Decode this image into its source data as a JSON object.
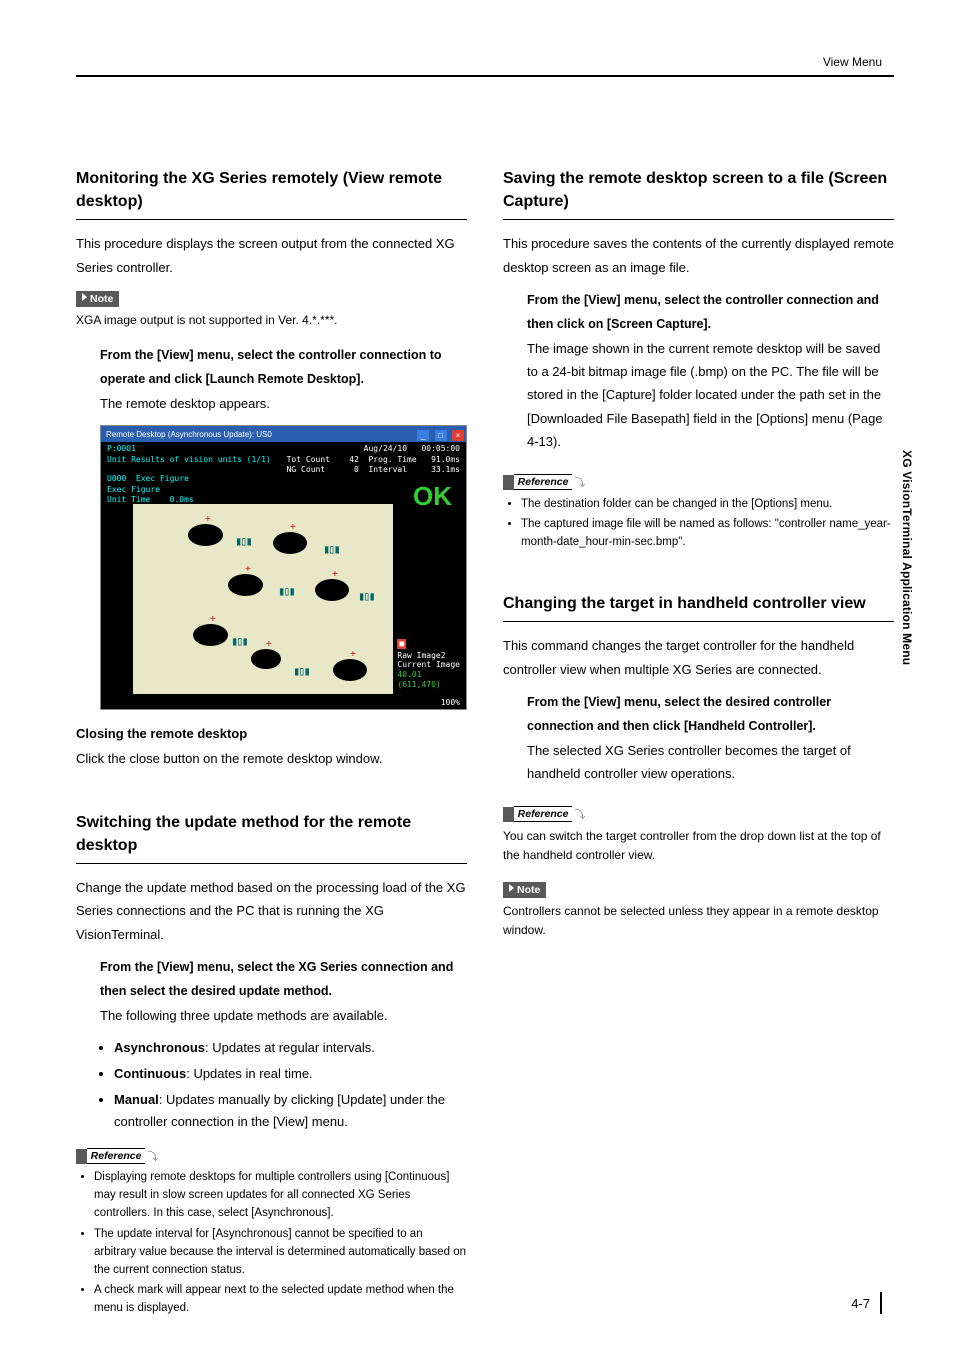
{
  "header": {
    "section_label": "View Menu"
  },
  "side_tab": "XG VisionTerminal Application Menu",
  "left": {
    "sec1": {
      "title": "Monitoring the XG Series remotely (View remote desktop)",
      "intro": "This procedure displays the screen output from the connected XG Series controller.",
      "note_label": "Note",
      "note_text": "XGA image output is not supported in Ver. 4.*.***.",
      "step_head": "From the [View] menu, select the controller connection to operate and click [Launch Remote Desktop].",
      "step_body": "The remote desktop appears.",
      "fig": {
        "titlebar": "Remote Desktop (Asynchronous Update): US0",
        "top_left_l1": "P:0001",
        "top_left_l2": "Unit Results of vision units (1/1)",
        "top_right": "Aug/24/10   00:05:00\nTot Count    42  Prog. Time   91.0ms\nNG Count      0  Interval     33.1ms",
        "left_stats": "U000  Exec Figure\nExec Figure\nUnit Time    0.0ms",
        "ok": "OK",
        "rside_flag": "■",
        "rside_lines": "Raw Image2\nCurrent Image",
        "rside_green": "40.01\n(611,470)",
        "bottom_pct": "100%"
      },
      "sub_head": "Closing the remote desktop",
      "sub_body": "Click the close button on the remote desktop window."
    },
    "sec2": {
      "title": "Switching the update method for the remote desktop",
      "intro": "Change the update method based on the processing load of the XG Series connections and the PC that is running the XG VisionTerminal.",
      "step_head": "From the [View] menu, select the XG Series connection and then select the desired update method.",
      "step_body": "The following three update methods are available.",
      "bullets": [
        {
          "b": "Asynchronous",
          "t": ": Updates at regular intervals."
        },
        {
          "b": "Continuous",
          "t": ": Updates in real time."
        },
        {
          "b": "Manual",
          "t": ": Updates manually by clicking [Update] under the controller connection in the [View] menu."
        }
      ],
      "ref_label": "Reference",
      "refs": [
        "Displaying remote desktops for multiple controllers using [Continuous] may result in slow screen updates for all connected XG Series controllers. In this case, select [Asynchronous].",
        "The update interval for [Asynchronous] cannot be specified to an arbitrary value because the interval is determined automatically based on the current connection status.",
        "A check mark will appear next to the selected update method when the menu is displayed."
      ]
    }
  },
  "right": {
    "sec1": {
      "title": "Saving the remote desktop screen to a file (Screen Capture)",
      "intro": "This procedure saves the contents of the currently displayed remote desktop screen as an image file.",
      "step_head": "From the [View] menu, select the controller connection and then click on [Screen Capture].",
      "step_body": "The image shown in the current remote desktop will be saved to a 24-bit bitmap image file (.bmp) on the PC. The file will be stored in the [Capture] folder located under the path set in the [Downloaded File Basepath] field in the [Options] menu (Page 4-13).",
      "ref_label": "Reference",
      "refs": [
        "The destination folder can be changed in the [Options] menu.",
        "The captured image file will be named as follows: \"controller name_year-month-date_hour-min-sec.bmp\"."
      ]
    },
    "sec2": {
      "title": "Changing the target in handheld controller view",
      "intro": "This command changes the target controller for the handheld controller view when multiple XG Series are connected.",
      "step_head": "From the [View] menu, select the desired controller connection and then click [Handheld Controller].",
      "step_body": "The selected XG Series controller becomes the target of handheld controller view operations.",
      "ref_label": "Reference",
      "ref_text": "You can switch the target controller from the drop down list at the top of the handheld controller view.",
      "note_label": "Note",
      "note_text": "Controllers cannot be selected unless they appear in a remote desktop window."
    }
  },
  "footer": {
    "page": "4-7"
  }
}
